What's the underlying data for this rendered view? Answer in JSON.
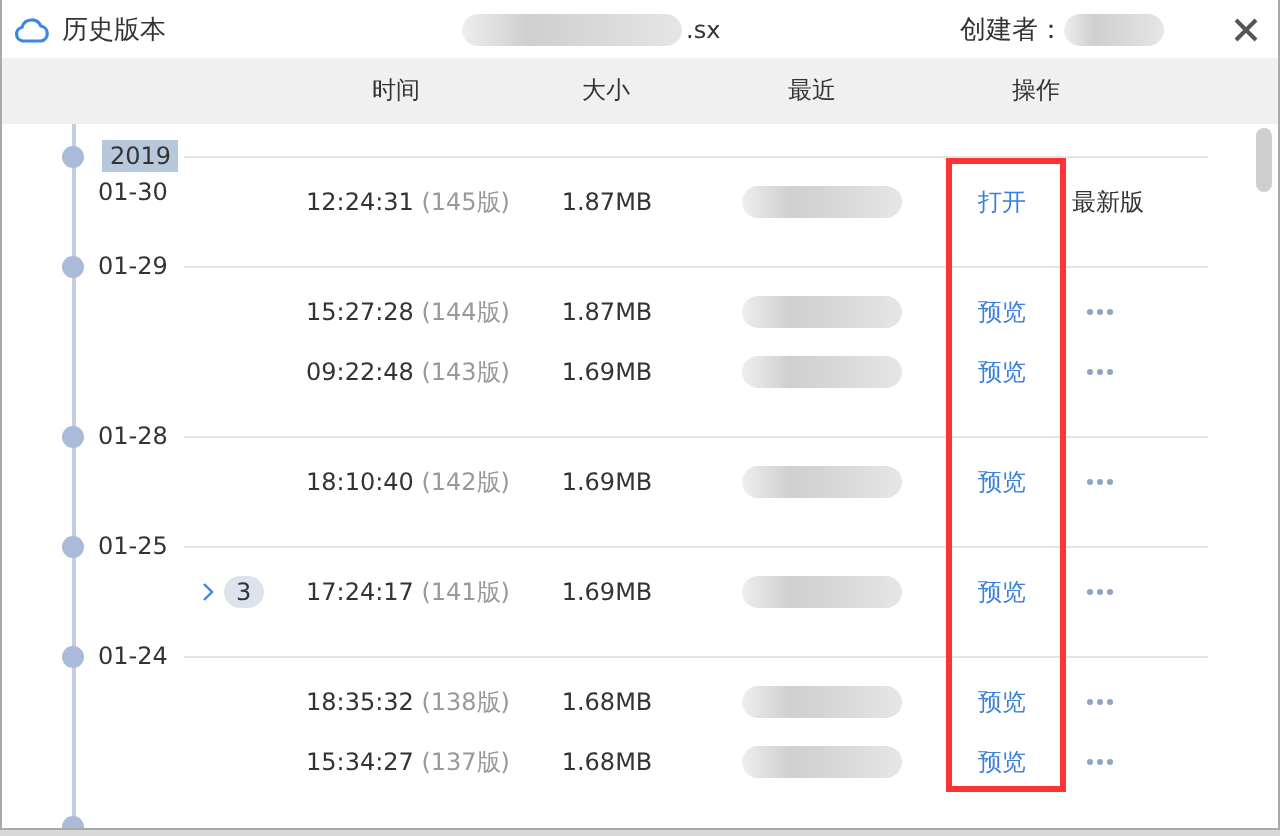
{
  "window": {
    "title": "历史版本",
    "file_name": ".sx",
    "creator_label": "创建者："
  },
  "columns": [
    "时间",
    "大小",
    "最近",
    "操作"
  ],
  "groups": [
    {
      "year": "2019",
      "date": "01-30",
      "versions": [
        {
          "time": "12:24:31",
          "version": "(145版)",
          "size": "1.87MB",
          "action": "打开",
          "kind": "latest",
          "extra": "最新版"
        }
      ]
    },
    {
      "date": "01-29",
      "versions": [
        {
          "time": "15:27:28",
          "version": "(144版)",
          "size": "1.87MB",
          "action": "预览",
          "kind": "more"
        },
        {
          "time": "09:22:48",
          "version": "(143版)",
          "size": "1.69MB",
          "action": "预览",
          "kind": "more"
        }
      ]
    },
    {
      "date": "01-28",
      "versions": [
        {
          "time": "18:10:40",
          "version": "(142版)",
          "size": "1.69MB",
          "action": "预览",
          "kind": "more"
        }
      ]
    },
    {
      "date": "01-25",
      "versions": [
        {
          "time": "17:24:17",
          "version": "(141版)",
          "size": "1.69MB",
          "action": "预览",
          "kind": "more",
          "group_count": "3",
          "expanded": false
        }
      ]
    },
    {
      "date": "01-24",
      "versions": [
        {
          "time": "18:35:32",
          "version": "(138版)",
          "size": "1.68MB",
          "action": "预览",
          "kind": "more"
        },
        {
          "time": "15:34:27",
          "version": "(137版)",
          "size": "1.68MB",
          "action": "预览",
          "kind": "more"
        }
      ]
    },
    {
      "cut_off": true
    }
  ]
}
